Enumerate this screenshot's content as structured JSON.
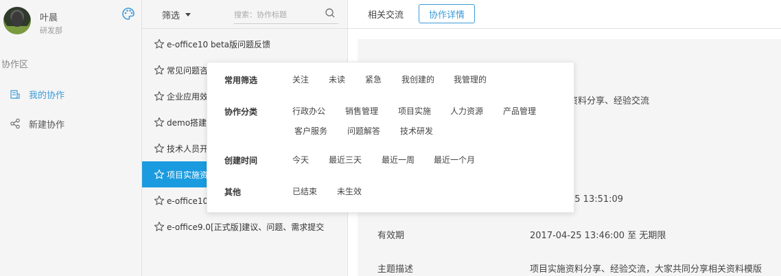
{
  "user": {
    "name": "叶晨",
    "department": "研发部"
  },
  "sidebar": {
    "section_title": "协作区",
    "items": [
      {
        "label": "我的协作",
        "icon": "collab-icon",
        "active": true
      },
      {
        "label": "新建协作",
        "icon": "share-icon",
        "active": false
      }
    ]
  },
  "list": {
    "filter_label": "筛选",
    "search_placeholder": "搜索：协作标题",
    "items": [
      {
        "title": "e-office10 beta版问题反馈"
      },
      {
        "title": "常见问题咨询"
      },
      {
        "title": "企业应用效果"
      },
      {
        "title": "demo搭建问题"
      },
      {
        "title": "技术人员开发"
      },
      {
        "title": "项目实施资料分享",
        "selected": true
      },
      {
        "title": "e-office10 正式版"
      },
      {
        "title": "e-office9.0[正式版]建议、问题、需求提交"
      }
    ]
  },
  "tabs": [
    {
      "label": "相关交流",
      "active": false
    },
    {
      "label": "协作详情",
      "active": true
    }
  ],
  "detail": {
    "title": "协作详情",
    "title_partial": "协作详情",
    "subject_fragment": "资料分享、经验交流",
    "created_fragment": "25 13:51:09",
    "validity_label": "有效期",
    "validity_value": "2017-04-25 13:46:00 至 无期限",
    "desc_label": "主题描述",
    "desc_value": "项目实施资料分享、经验交流，大家共同分享相关资料模版"
  },
  "filter_dropdown": {
    "rows": [
      {
        "label": "常用筛选",
        "options": [
          "关注",
          "未读",
          "紧急",
          "我创建的",
          "我管理的"
        ]
      },
      {
        "label": "协作分类",
        "options": [
          "行政办公",
          "销售管理",
          "项目实施",
          "人力资源",
          "产品管理",
          "客户服务",
          "问题解答",
          "技术研发"
        ]
      },
      {
        "label": "创建时间",
        "options": [
          "今天",
          "最近三天",
          "最近一周",
          "最近一个月"
        ]
      },
      {
        "label": "其他",
        "options": [
          "已结束",
          "未生效"
        ]
      }
    ]
  },
  "colors": {
    "accent": "#1a9be0",
    "link": "#3a9ad9"
  }
}
